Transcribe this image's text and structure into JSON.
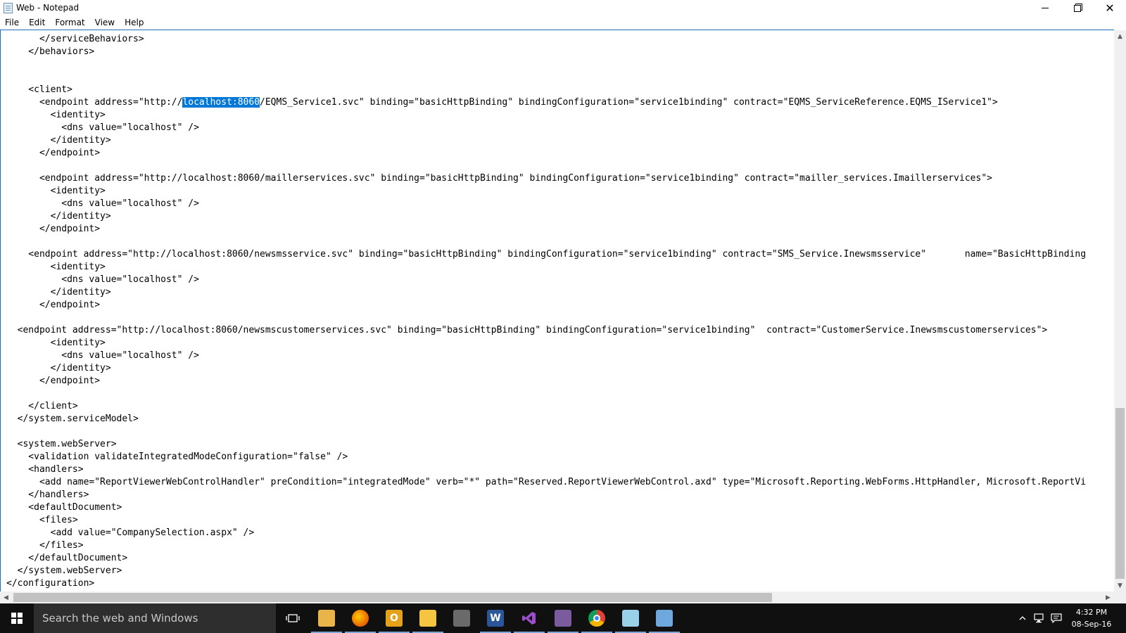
{
  "window": {
    "title": "Web - Notepad",
    "minimize_icon": "minimize-icon",
    "maximize_icon": "restore-icon",
    "close_glyph": "✕"
  },
  "menu": [
    "File",
    "Edit",
    "Format",
    "View",
    "Help"
  ],
  "editor": {
    "selection": "localhost:8060",
    "lines": [
      "      </serviceBehaviors>",
      "    </behaviors>",
      "",
      "",
      "    <client>",
      "      <endpoint address=\"http://localhost:8060/EQMS_Service1.svc\" binding=\"basicHttpBinding\" bindingConfiguration=\"service1binding\" contract=\"EQMS_ServiceReference.EQMS_IService1\">",
      "        <identity>",
      "          <dns value=\"localhost\" />",
      "        </identity>",
      "      </endpoint>",
      "",
      "      <endpoint address=\"http://localhost:8060/maillerservices.svc\" binding=\"basicHttpBinding\" bindingConfiguration=\"service1binding\" contract=\"mailler_services.Imaillerservices\">",
      "        <identity>",
      "          <dns value=\"localhost\" />",
      "        </identity>",
      "      </endpoint>",
      "",
      "    <endpoint address=\"http://localhost:8060/newsmsservice.svc\" binding=\"basicHttpBinding\" bindingConfiguration=\"service1binding\" contract=\"SMS_Service.Inewsmsservice\"       name=\"BasicHttpBinding",
      "        <identity>",
      "          <dns value=\"localhost\" />",
      "        </identity>",
      "      </endpoint>",
      "",
      "  <endpoint address=\"http://localhost:8060/newsmscustomerservices.svc\" binding=\"basicHttpBinding\" bindingConfiguration=\"service1binding\"  contract=\"CustomerService.Inewsmscustomerservices\">",
      "        <identity>",
      "          <dns value=\"localhost\" />",
      "        </identity>",
      "      </endpoint>",
      "",
      "    </client>",
      "  </system.serviceModel>",
      "",
      "  <system.webServer>",
      "    <validation validateIntegratedModeConfiguration=\"false\" />",
      "    <handlers>",
      "      <add name=\"ReportViewerWebControlHandler\" preCondition=\"integratedMode\" verb=\"*\" path=\"Reserved.ReportViewerWebControl.axd\" type=\"Microsoft.Reporting.WebForms.HttpHandler, Microsoft.ReportVi",
      "    </handlers>",
      "    <defaultDocument>",
      "      <files>",
      "        <add value=\"CompanySelection.aspx\" />",
      "      </files>",
      "    </defaultDocument>",
      "  </system.webServer>",
      "</configuration>"
    ]
  },
  "taskbar": {
    "search_placeholder": "Search the web and Windows",
    "icons": [
      {
        "name": "task-view-icon",
        "label": "",
        "color": "#101010"
      },
      {
        "name": "file-explorer-folder-icon",
        "label": "",
        "color": "#e8b54a"
      },
      {
        "name": "firefox-icon",
        "label": "",
        "color": "#e66000"
      },
      {
        "name": "outlook-icon",
        "label": "O",
        "color": "#e3a21a"
      },
      {
        "name": "file-explorer-icon",
        "label": "",
        "color": "#f5c542"
      },
      {
        "name": "snipping-tool-icon",
        "label": "",
        "color": "#6a6a6a"
      },
      {
        "name": "word-icon",
        "label": "W",
        "color": "#2b579a"
      },
      {
        "name": "visual-studio-icon",
        "label": "",
        "color": "#68217a"
      },
      {
        "name": "winrar-icon",
        "label": "",
        "color": "#7a5c9e"
      },
      {
        "name": "chrome-icon",
        "label": "",
        "color": "#dd4b39"
      },
      {
        "name": "notepad-icon",
        "label": "",
        "color": "#9ad0ea"
      },
      {
        "name": "paint-icon",
        "label": "",
        "color": "#6fa8dc"
      }
    ],
    "clock": {
      "time": "4:32 PM",
      "date": "08-Sep-16"
    }
  }
}
